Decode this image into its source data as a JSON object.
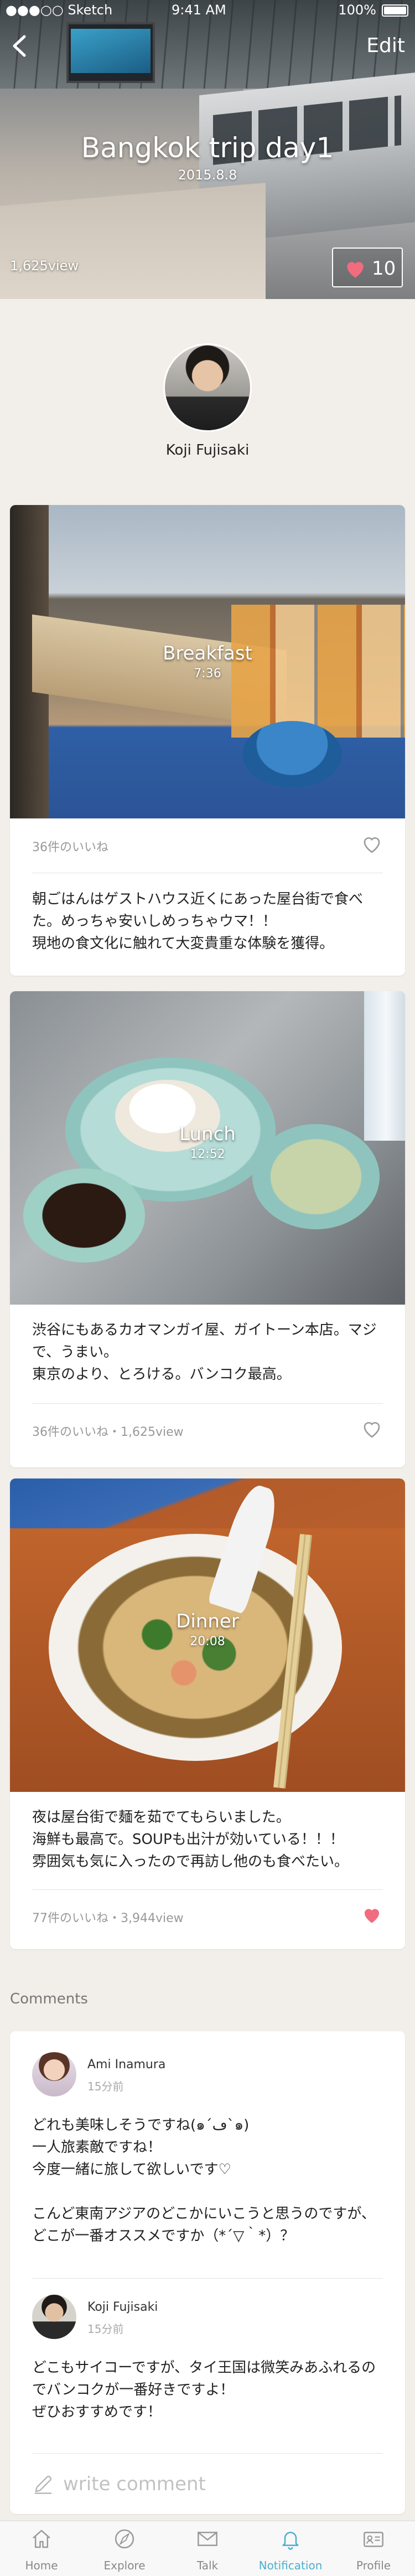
{
  "status_bar": {
    "carrier": "●●●○○ Sketch",
    "time": "9:41 AM",
    "battery": "100%"
  },
  "header": {
    "back_icon": "chevron-left-icon",
    "edit_label": "Edit"
  },
  "trip": {
    "title": "Bangkok trip day1",
    "date": "2015.8.8",
    "views": "1,625view",
    "like_count": "10",
    "like_color": "#f06c7e"
  },
  "author": {
    "name": "Koji Fujisaki"
  },
  "posts": [
    {
      "title": "Breakfast",
      "time": "7:36",
      "meta": "36件のいいね",
      "text": "朝ごはんはゲストハウス近くにあった屋台街で食べた。めっちゃ安いしめっちゃウマ！！\n現地の食文化に触れて大変貴重な体験を獲得。",
      "liked": false
    },
    {
      "title": "Lunch",
      "time": "12:52",
      "meta": "36件のいいね・1,625view",
      "text": "渋谷にもあるカオマンガイ屋、ガイトーン本店。マジで、うまい。\n東京のより、とろける。バンコク最高。",
      "liked": false
    },
    {
      "title": "Dinner",
      "time": "20:08",
      "meta": "77件のいいね・3,944view",
      "text": "夜は屋台街で麺を茹でてもらいました。\n海鮮も最高で。SOUPも出汁が効いている！！！\n雰囲気も気に入ったので再訪し他のも食べたい。",
      "liked": true
    }
  ],
  "comments": {
    "title": "Comments",
    "items": [
      {
        "name": "Ami Inamura",
        "time": "15分前",
        "text": "どれも美味しそうですね(๑´ڡ`๑)\n一人旅素敵ですね！\n今度一緒に旅して欲しいです♡\n\nこんど東南アジアのどこかにいこうと思うのですが、どこが一番オススメですか（*´▽｀*）？"
      },
      {
        "name": "Koji Fujisaki",
        "time": "15分前",
        "text": "どこもサイコーですが、タイ王国は微笑みあふれるのでバンコクが一番好きですよ！\nぜひおすすめです！"
      }
    ],
    "write_placeholder": "write comment",
    "write_icon": "pencil-icon"
  },
  "tabbar": {
    "active_color": "#4aaed0",
    "items": [
      {
        "label": "Home",
        "icon": "home-icon"
      },
      {
        "label": "Explore",
        "icon": "compass-icon"
      },
      {
        "label": "Talk",
        "icon": "mail-icon"
      },
      {
        "label": "Notification",
        "icon": "bell-icon",
        "active": true
      },
      {
        "label": "Profile",
        "icon": "profile-card-icon"
      }
    ]
  }
}
